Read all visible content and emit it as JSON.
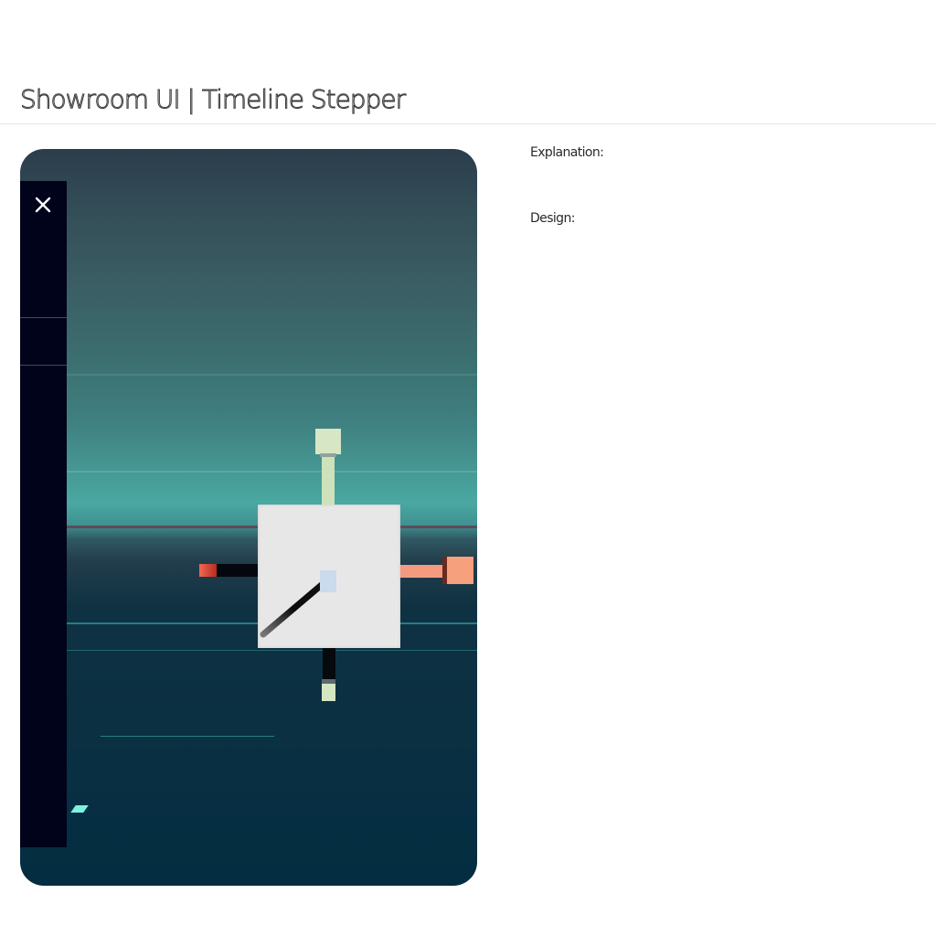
{
  "page": {
    "title": "Showroom UI | Timeline Stepper"
  },
  "preview": {
    "close_icon": "close-icon"
  },
  "info": {
    "explanation_label": "Explanation:",
    "design_label": "Design:"
  },
  "colors": {
    "sky_top": "#2b3d4c",
    "horizon": "#4aa8a2",
    "ground": "#042d41",
    "side_panel": "#01031a",
    "node_green": "#d7e6c4",
    "node_coral": "#f6a07e",
    "node_red": "#f06a52",
    "center_card": "#e8e7e7"
  }
}
